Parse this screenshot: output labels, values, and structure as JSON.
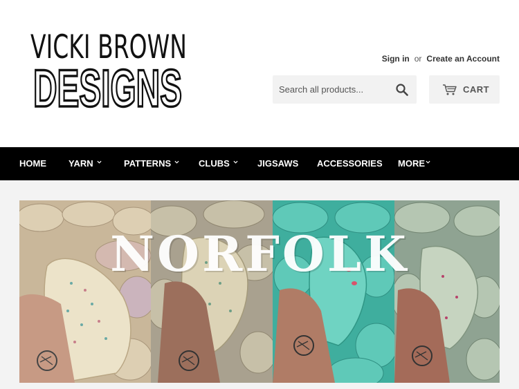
{
  "brand": {
    "line1": "VICKI BROWN",
    "line2": "DESIGNS"
  },
  "account": {
    "sign_in": "Sign in",
    "or": "or",
    "create": "Create an Account"
  },
  "search": {
    "placeholder": "Search all products...",
    "icon": "search-icon"
  },
  "cart": {
    "label": "CART",
    "icon": "cart-icon"
  },
  "nav": {
    "items": [
      {
        "label": "HOME"
      },
      {
        "label": "YARN"
      },
      {
        "label": "PATTERNS"
      },
      {
        "label": "CLUBS"
      },
      {
        "label": "JIGSAWS"
      },
      {
        "label": "ACCESSORIES"
      },
      {
        "label": "MORE"
      }
    ]
  },
  "hero": {
    "text": "NORFOLK"
  },
  "colors": {
    "nav_bg": "#000000",
    "content_bg": "#f3f3f3",
    "button_bg": "#f2f2f2",
    "yarn_teal": "#5fc9b8",
    "yarn_cream": "#e8dcc0"
  }
}
